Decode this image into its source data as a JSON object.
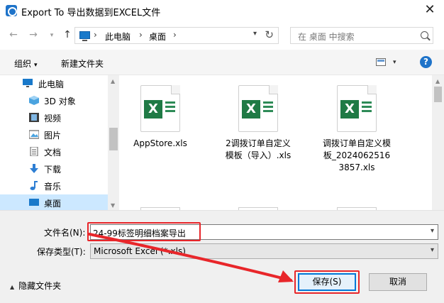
{
  "window": {
    "title": "Export To 导出数据到EXCEL文件",
    "close_glyph": "✕"
  },
  "nav": {
    "back_glyph": "←",
    "forward_glyph": "→",
    "recent_glyph": "▾",
    "up_glyph": "↑",
    "breadcrumb": [
      "此电脑",
      "桌面"
    ],
    "sep_glyph": "›",
    "dropdown_glyph": "▾",
    "refresh_glyph": "↻",
    "search_placeholder": "在 桌面 中搜索"
  },
  "toolbar": {
    "organize_label": "组织",
    "new_folder_label": "新建文件夹",
    "caret_glyph": "▾",
    "help_glyph": "?"
  },
  "sidebar": {
    "items": [
      {
        "label": "此电脑",
        "icon": "pc-icon"
      },
      {
        "label": "3D 对象",
        "icon": "cube-icon"
      },
      {
        "label": "视频",
        "icon": "film-icon"
      },
      {
        "label": "图片",
        "icon": "picture-icon"
      },
      {
        "label": "文档",
        "icon": "document-icon"
      },
      {
        "label": "下载",
        "icon": "download-arrow-icon"
      },
      {
        "label": "音乐",
        "icon": "music-note-icon"
      },
      {
        "label": "桌面",
        "icon": "desktop-icon",
        "selected": true
      }
    ],
    "scroll_up_glyph": "▲",
    "scroll_down_glyph": "▼"
  },
  "files": [
    {
      "name": "AppStore.xls"
    },
    {
      "name": "2调拨订单自定义模板（导入）.xls"
    },
    {
      "name": "调拨订单自定义模板_20240625163857.xls"
    }
  ],
  "file_badge_letter": "X",
  "form": {
    "filename_label": "文件名(N):",
    "filename_value": "24-99标签明细档案导出",
    "filetype_label": "保存类型(T):",
    "filetype_value": "Microsoft Excel (*.xls)",
    "dropdown_glyph": "▾",
    "hide_folders_label": "隐藏文件夹",
    "hide_caret_glyph": "▲",
    "save_label": "保存(S)",
    "cancel_label": "取消"
  },
  "annotation_color": "#e8262a",
  "accent_color": "#0078d7"
}
